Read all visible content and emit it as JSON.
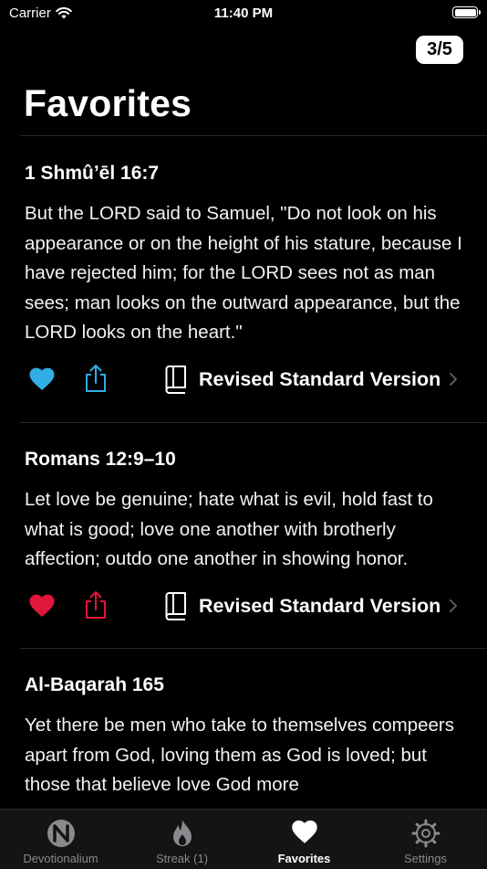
{
  "status_bar": {
    "carrier": "Carrier",
    "time": "11:40 PM"
  },
  "page_indicator": "3/5",
  "title": "Favorites",
  "cards": [
    {
      "reference": "1 Shmûʼēl 16:7",
      "text": "But the LORD said to Samuel, \"Do not look on his appearance or on the height of his stature, because I have rejected him; for the LORD sees not as man sees; man looks on the outward appearance, but the LORD looks on the heart.\"",
      "version": "Revised Standard Version",
      "accent": "#32ade6",
      "favorited": true
    },
    {
      "reference": "Romans 12:9–10",
      "text": "Let love be genuine; hate what is evil, hold fast to what is good; love one another with brotherly affection; outdo one another in showing honor.",
      "version": "Revised Standard Version",
      "accent": "#e0163a",
      "favorited": true
    },
    {
      "reference": "Al-Baqarah 165",
      "text": "Yet there be men who take to themselves compeers apart from God, loving them as God is loved; but those that believe love God more"
    }
  ],
  "tabs": [
    {
      "label": "Devotionalium",
      "icon": "devotionalium-logo-icon",
      "active": false
    },
    {
      "label": "Streak (1)",
      "icon": "flame-icon",
      "active": false
    },
    {
      "label": "Favorites",
      "icon": "heart-icon",
      "active": true
    },
    {
      "label": "Settings",
      "icon": "gear-icon",
      "active": false
    }
  ]
}
